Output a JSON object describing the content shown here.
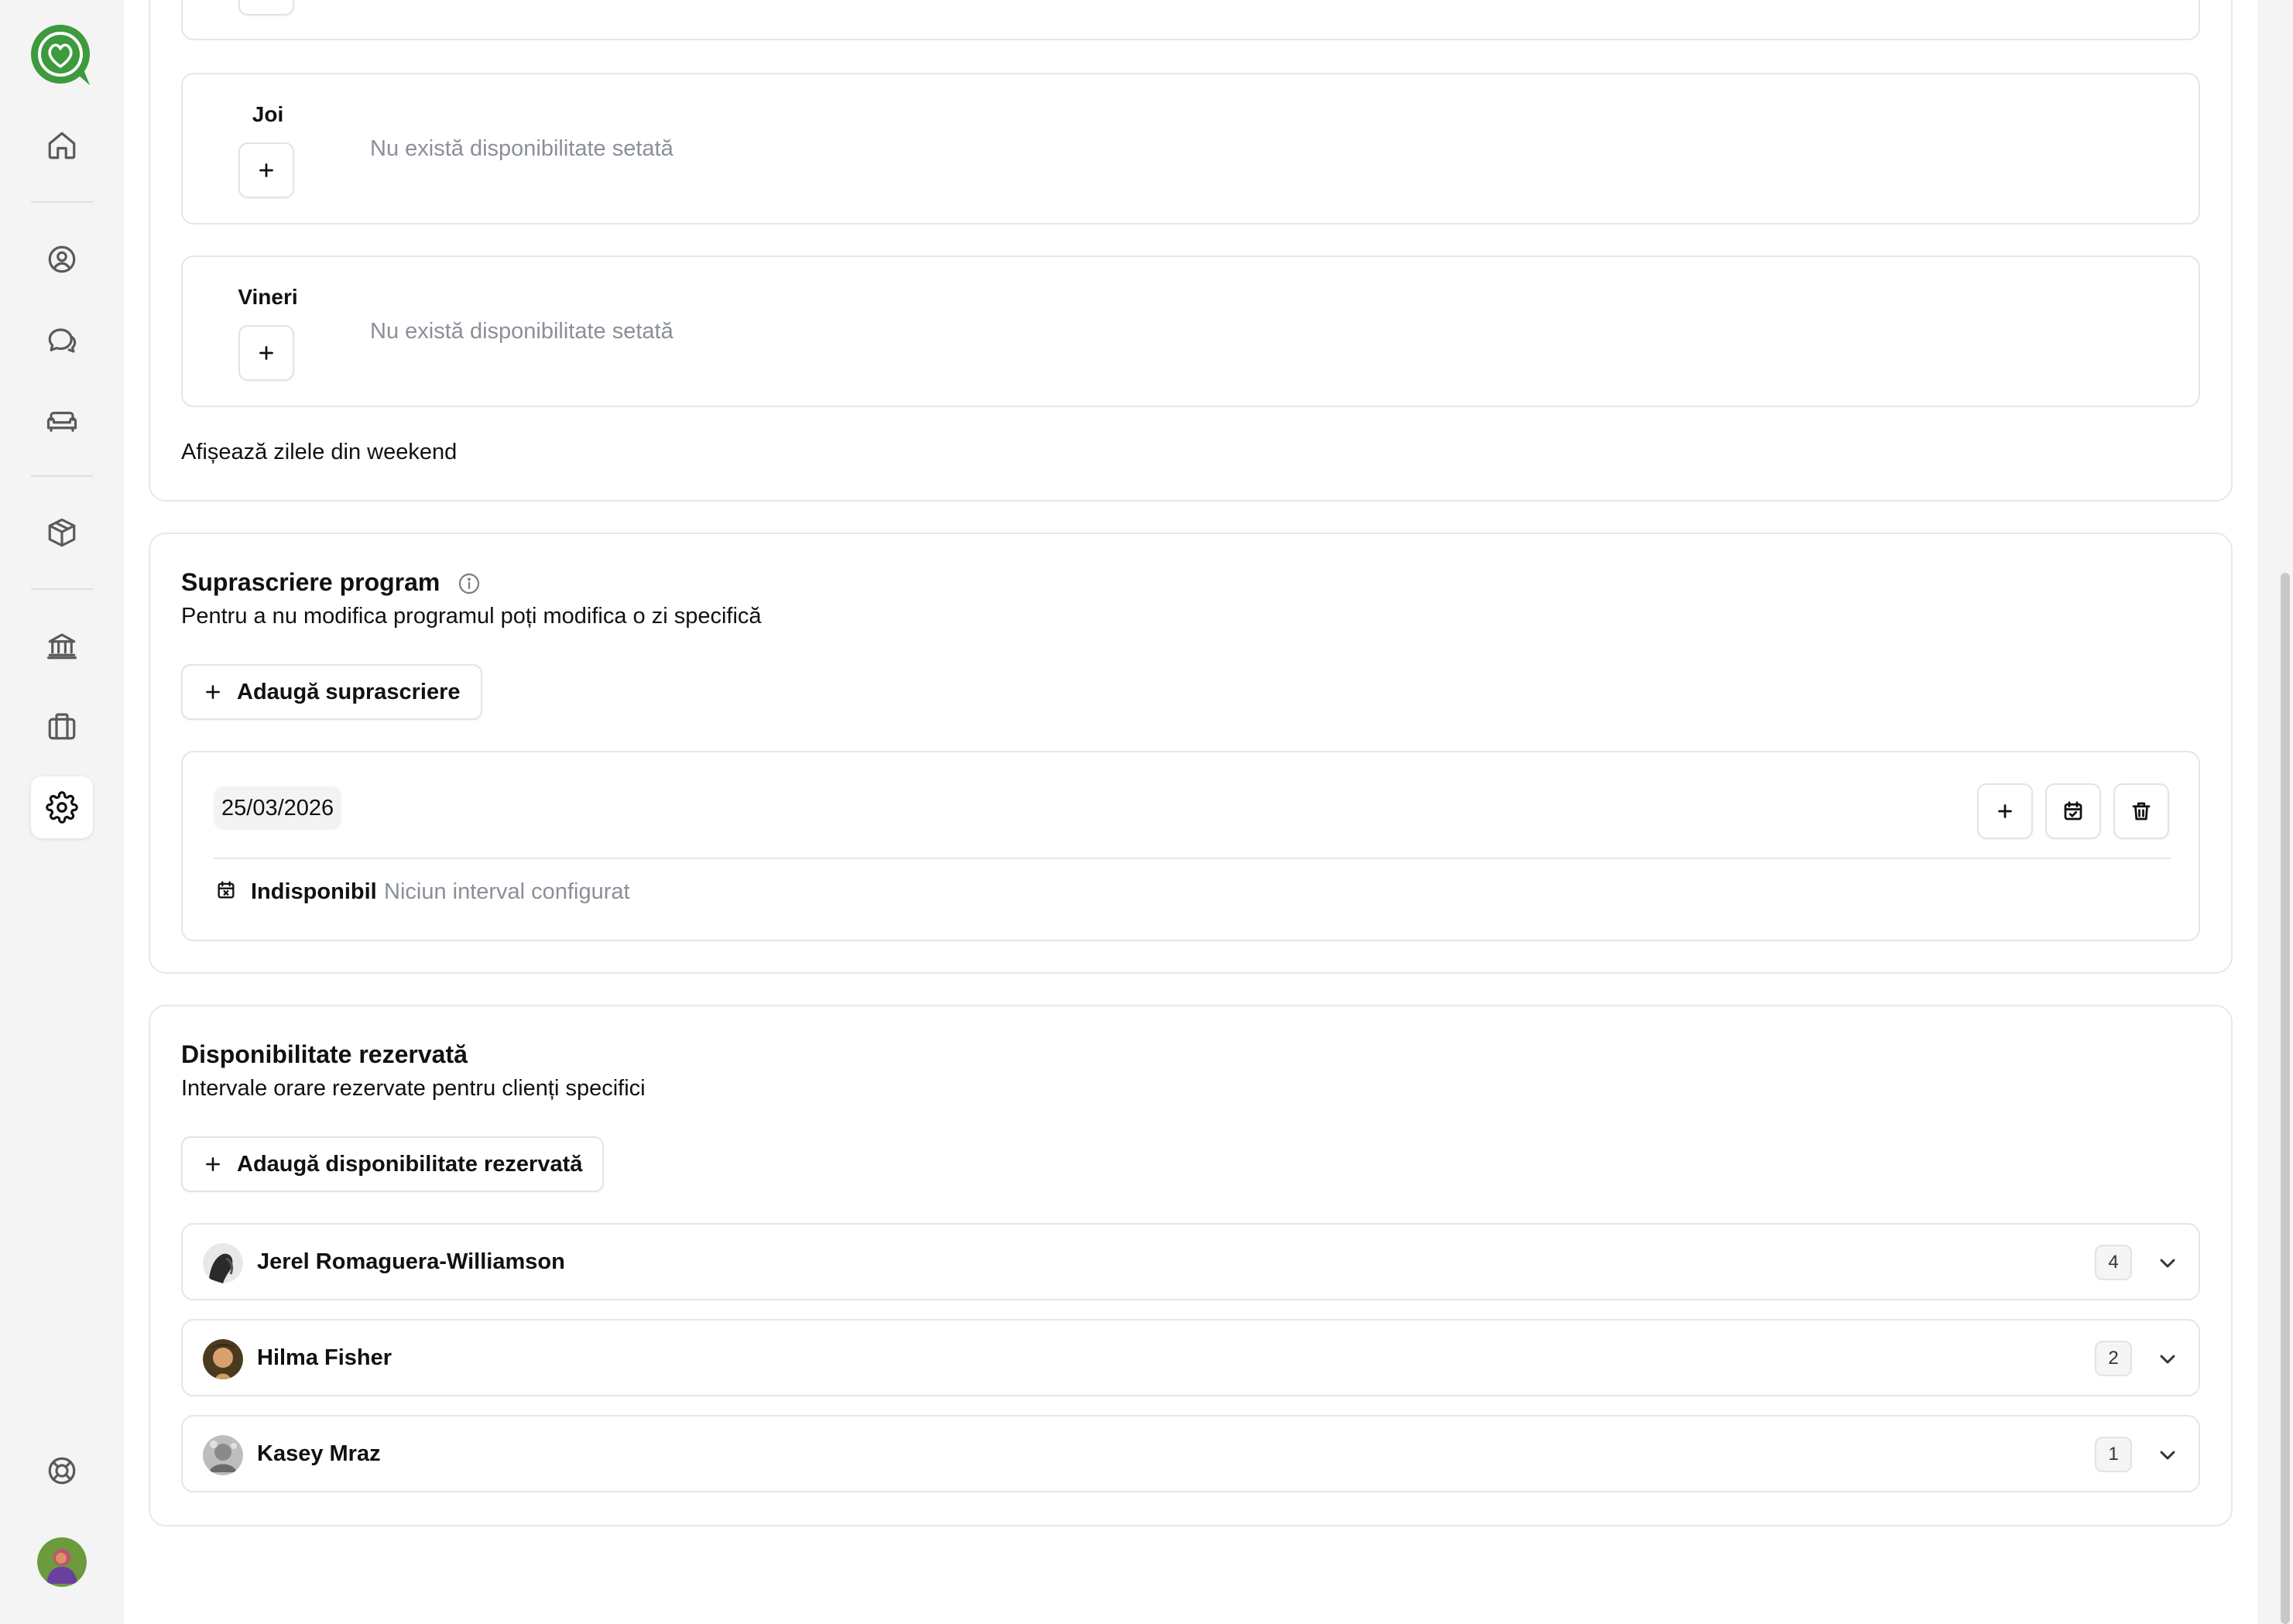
{
  "schedule": {
    "days": [
      {
        "label": "Joi",
        "empty_text": "Nu există disponibilitate setată"
      },
      {
        "label": "Vineri",
        "empty_text": "Nu există disponibilitate setată"
      }
    ],
    "weekend_toggle_label": "Afișează zilele din weekend"
  },
  "override": {
    "title": "Suprascriere program",
    "subtitle": "Pentru a nu modifica programul poți modifica o zi specifică",
    "add_label": "Adaugă suprascriere",
    "entry": {
      "date": "25/03/2026",
      "status": "Indisponibil",
      "detail": "Niciun interval configurat"
    }
  },
  "reserved": {
    "title": "Disponibilitate rezervată",
    "subtitle": "Intervale orare rezervate pentru clienți specifici",
    "add_label": "Adaugă disponibilitate rezervată",
    "clients": [
      {
        "name": "Jerel Romaguera-Williamson",
        "count": "4"
      },
      {
        "name": "Hilma Fisher",
        "count": "2"
      },
      {
        "name": "Kasey Mraz",
        "count": "1"
      }
    ]
  },
  "sidebar": {
    "icons": [
      "logo-icon",
      "home-icon",
      "user-icon",
      "chat-icon",
      "sofa-icon",
      "package-icon",
      "bank-icon",
      "briefcase-icon",
      "settings-icon",
      "help-icon"
    ],
    "active": "settings-icon"
  },
  "colors": {
    "brand_green": "#3d9a3d",
    "muted_text": "#8a8f98",
    "border": "#e6e6e6"
  }
}
